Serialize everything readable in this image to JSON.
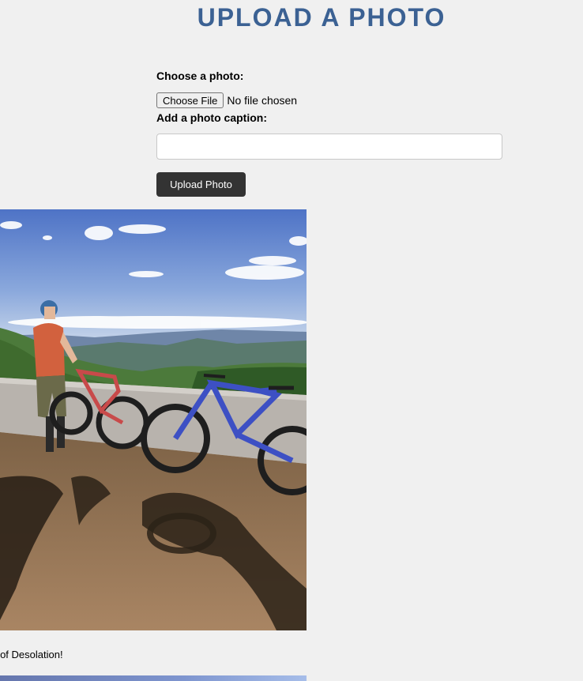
{
  "header": {
    "title": "UPLOAD A PHOTO"
  },
  "form": {
    "choose_photo_label": "Choose a photo:",
    "choose_file_button": "Choose File",
    "file_status": "No file chosen",
    "caption_label": "Add a photo caption:",
    "caption_value": "",
    "caption_placeholder": "",
    "upload_button": "Upload Photo"
  },
  "gallery": {
    "items": [
      {
        "caption": "op of Desolation!",
        "image": "mountain-bikers-overlook-photo"
      }
    ]
  },
  "colors": {
    "title": "#3b6193",
    "background": "#f0f0f0",
    "button": "#333333"
  }
}
